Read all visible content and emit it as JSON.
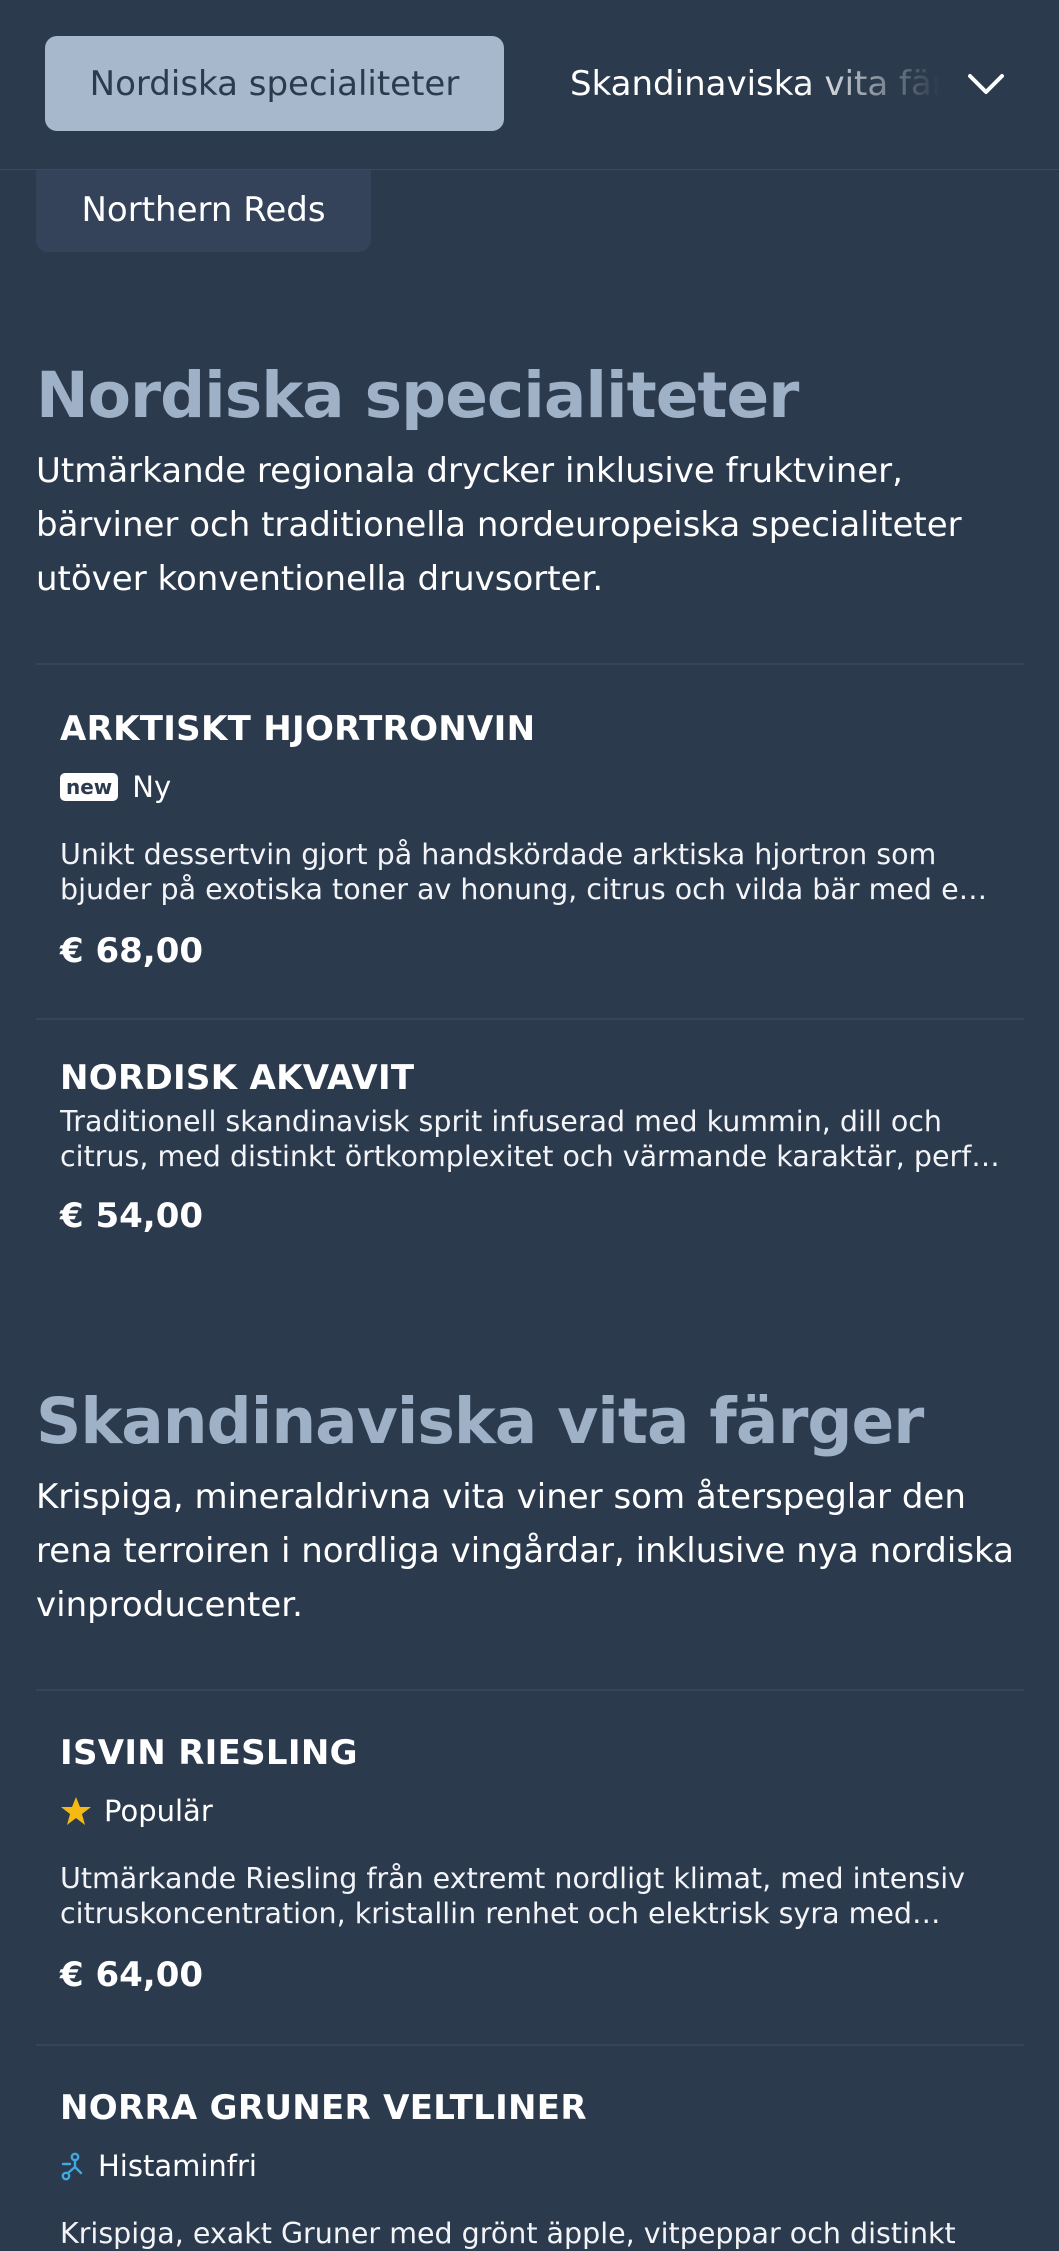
{
  "topbar": {
    "active_tab": "Nordiska specialiteter",
    "next_tab": "Skandinaviska vita färger",
    "prev_chip": "Northern Reds"
  },
  "sections": [
    {
      "title": "Nordiska specialiteter",
      "description_lines": [
        "Utmärkande regionala drycker inklusive fruktviner,",
        "bärviner och traditionella nordeuropeiska specialiteter",
        "utöver konventionella druvsorter."
      ],
      "items": [
        {
          "name": "ARKTISKT HJORTRONVIN",
          "badge_tag": "new",
          "badge_label": "Ny",
          "desc_lines": [
            "Unikt dessertvin gjort på handskördade arktiska hjortron som",
            "bjuder på exotiska toner av honung, citrus och vilda bär med en…"
          ],
          "price": "€ 68,00"
        },
        {
          "name": "NORDISK AKVAVIT",
          "desc_lines": [
            "Traditionell skandinavisk sprit infuserad med kummin, dill och",
            "citrus, med distinkt örtkomplexitet och värmande karaktär, perfe…"
          ],
          "price": "€ 54,00"
        }
      ]
    },
    {
      "title": "Skandinaviska vita färger",
      "description_lines": [
        "Krispiga, mineraldrivna vita viner som återspeglar den",
        "rena terroiren i nordliga vingårdar, inklusive nya nordiska",
        "vinproducenter."
      ],
      "items": [
        {
          "name": "ISVIN RIESLING",
          "badge_icon": "star-icon",
          "badge_label": "Populär",
          "desc_lines": [
            "Utmärkande Riesling från extremt nordligt klimat, med intensiv",
            "citruskoncentration, kristallin renhet och elektrisk syra med…"
          ],
          "price": "€ 64,00"
        },
        {
          "name": "NORRA GRUNER VELTLINER",
          "badge_icon": "histamine-free-icon",
          "badge_label": "Histaminfri",
          "desc_lines": [
            "Krispiga, exakt Gruner med grönt äpple, vitpeppar och distinkt"
          ]
        }
      ]
    }
  ],
  "colors": {
    "background": "#2c3a4e",
    "active_tab_bg": "#a7b8cc",
    "heading": "#9fb1c6",
    "star": "#f5b914",
    "histamine_icon": "#3fa9e0"
  }
}
